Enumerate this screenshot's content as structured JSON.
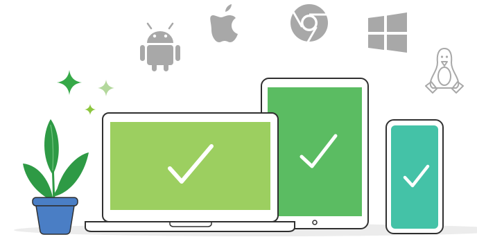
{
  "illustration": {
    "platform_icons": [
      "android-icon",
      "apple-icon",
      "chrome-icon",
      "windows-icon",
      "linux-icon"
    ],
    "devices": [
      "laptop",
      "tablet",
      "phone"
    ],
    "device_screen_states": [
      "check-mark",
      "check-mark",
      "check-mark"
    ],
    "decorations": [
      "sparkle-icon",
      "sparkle-icon",
      "sparkle-icon",
      "potted-plant"
    ]
  },
  "colors": {
    "outline": "#2f2f2f",
    "platform_icon_gray": "#a8a8a8",
    "laptop_screen": "#9ccf60",
    "tablet_screen": "#5bbc62",
    "phone_screen": "#44c2a7",
    "check_mark": "#ffffff",
    "plant_leaf": "#2e9a45",
    "plant_pot": "#4a7ec5",
    "sparkle_dark": "#36a948",
    "sparkle_light": "#b3d89c",
    "sparkle_small": "#8cc63f",
    "ground_shadow": "#ececec"
  }
}
